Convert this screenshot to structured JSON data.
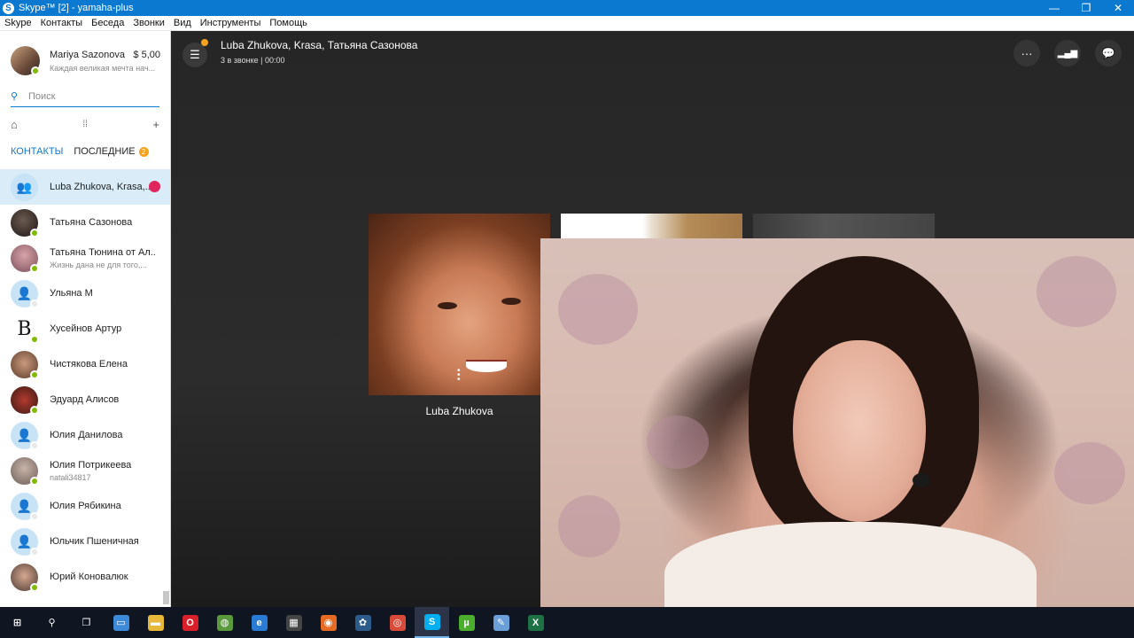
{
  "window": {
    "title": "Skype™ [2] - yamaha-plus",
    "logo_letter": "S",
    "minimize": "—",
    "restore": "❐",
    "close": "✕"
  },
  "menu": [
    "Skype",
    "Контакты",
    "Беседа",
    "Звонки",
    "Вид",
    "Инструменты",
    "Помощь"
  ],
  "profile": {
    "name": "Mariya Sazonova",
    "credit": "$ 5,00",
    "mood": "Каждая великая мечта нач..."
  },
  "search": {
    "placeholder": "Поиск",
    "icon": "search-icon"
  },
  "toolbar": {
    "home_icon": "⌂",
    "dialpad_icon": "⁞⁞",
    "add_icon": "+"
  },
  "tabs": {
    "contacts": "КОНТАКТЫ",
    "recent": "ПОСЛЕДНИЕ",
    "recent_badge": "2"
  },
  "contacts": [
    {
      "name": "Luba Zhukova, Krasa,...",
      "sub": "",
      "status": "none",
      "avatar": "group",
      "active": true,
      "badge": "⬤"
    },
    {
      "name": "Татьяна Сазонова",
      "sub": "",
      "status": "online",
      "avatar": "photo-dark"
    },
    {
      "name": "Татьяна Тюнина от Ал...",
      "sub": "Жизнь дана не для того,...",
      "status": "online",
      "avatar": "photo-pink"
    },
    {
      "name": "Ульяна М",
      "sub": "",
      "status": "offline",
      "avatar": "default"
    },
    {
      "name": "Хусейнов Артур",
      "sub": "",
      "status": "online",
      "avatar": "letter-b"
    },
    {
      "name": "Чистякова Елена",
      "sub": "",
      "status": "online",
      "avatar": "photo-brown"
    },
    {
      "name": "Эдуард Алисов",
      "sub": "",
      "status": "online",
      "avatar": "photo-red"
    },
    {
      "name": "Юлия Данилова",
      "sub": "",
      "status": "offline",
      "avatar": "default"
    },
    {
      "name": "Юлия Потрикеева",
      "sub": "natali34817",
      "status": "online",
      "avatar": "photo-gray"
    },
    {
      "name": "Юлия Рябикина",
      "sub": "",
      "status": "offline",
      "avatar": "default"
    },
    {
      "name": "Юльчик Пшеничная",
      "sub": "",
      "status": "offline",
      "avatar": "default"
    },
    {
      "name": "Юрий Коновалюк",
      "sub": "",
      "status": "online",
      "avatar": "photo-man"
    }
  ],
  "call": {
    "title": "Luba Zhukova, Krasa, Татьяна Сазонова",
    "status": "3 в звонке | 00:00",
    "participant_label": "Luba Zhukova",
    "more_icon": "···",
    "signal_icon": "▂▄▆",
    "chat_icon": "💬",
    "menu_icon": "☰"
  },
  "taskbar": [
    {
      "name": "start-icon",
      "glyph": "⊞",
      "color": "#101522"
    },
    {
      "name": "search-icon",
      "glyph": "⚲",
      "color": "#101522"
    },
    {
      "name": "task-view-icon",
      "glyph": "❐",
      "color": "#101522"
    },
    {
      "name": "app-icon",
      "glyph": "▭",
      "color": "#3c8ad8"
    },
    {
      "name": "folder-icon",
      "glyph": "▬",
      "color": "#e8b83a"
    },
    {
      "name": "opera-icon",
      "glyph": "O",
      "color": "#d9202a"
    },
    {
      "name": "globe-icon",
      "glyph": "◍",
      "color": "#5a9a3c"
    },
    {
      "name": "edge-icon",
      "glyph": "e",
      "color": "#2a7bd4"
    },
    {
      "name": "calculator-icon",
      "glyph": "▦",
      "color": "#444"
    },
    {
      "name": "firefox-icon",
      "glyph": "◉",
      "color": "#e76b22"
    },
    {
      "name": "settings-app-icon",
      "glyph": "✿",
      "color": "#2e5c8a"
    },
    {
      "name": "chrome-icon",
      "glyph": "◎",
      "color": "#d94a38"
    },
    {
      "name": "skype-icon",
      "glyph": "S",
      "color": "#00aff0",
      "active": true
    },
    {
      "name": "utorrent-icon",
      "glyph": "µ",
      "color": "#4cae2d"
    },
    {
      "name": "editor-icon",
      "glyph": "✎",
      "color": "#6a9fd8"
    },
    {
      "name": "excel-icon",
      "glyph": "X",
      "color": "#1e7145"
    }
  ]
}
